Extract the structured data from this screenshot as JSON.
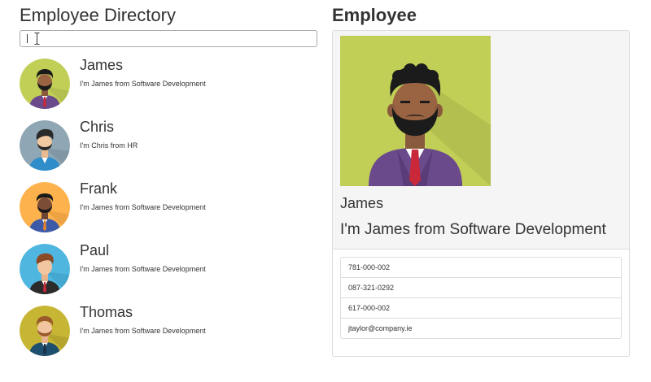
{
  "directory": {
    "title": "Employee Directory",
    "search": {
      "value": "",
      "placeholder": ""
    },
    "employees": [
      {
        "name": "James",
        "description": "I'm James from Software Development",
        "avatar_icon": "avatar-bearded-man-icon",
        "bg_color": "#c2cf57"
      },
      {
        "name": "Chris",
        "description": "I'm Chris from HR",
        "avatar_icon": "avatar-man-quiff-icon",
        "bg_color": "#8fa6b4"
      },
      {
        "name": "Frank",
        "description": "I'm James from Software Development",
        "avatar_icon": "avatar-bearded-man-icon",
        "bg_color": "#fdb24d"
      },
      {
        "name": "Paul",
        "description": "I'm James from Software Development",
        "avatar_icon": "avatar-man-tie-icon",
        "bg_color": "#4fb6e0"
      },
      {
        "name": "Thomas",
        "description": "I'm James from Software Development",
        "avatar_icon": "avatar-bearded-man-icon",
        "bg_color": "#c7b534"
      }
    ]
  },
  "detail": {
    "title": "Employee",
    "name": "James",
    "description": "I'm James from Software Development",
    "photo_icon": "employee-photo-icon",
    "photo_bg": "#c2cf57",
    "contacts": [
      "781-000-002",
      "087-321-0292",
      "617-000-002",
      "jtaylor@company.ie"
    ]
  }
}
